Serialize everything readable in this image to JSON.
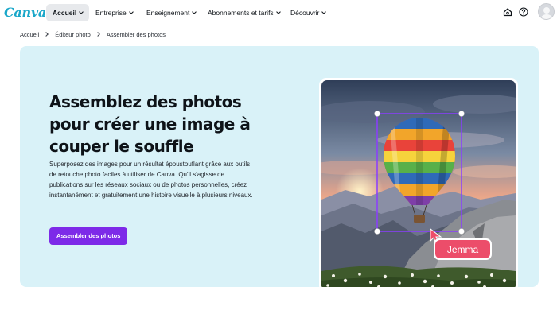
{
  "nav": {
    "logo": "Canva",
    "items": [
      {
        "label": "Accueil",
        "active": true
      },
      {
        "label": "Entreprise"
      },
      {
        "label": "Enseignement"
      },
      {
        "label": "Abonnements et tarifs"
      },
      {
        "label": "Découvrir"
      }
    ],
    "icons": [
      "home-icon",
      "help-icon",
      "avatar"
    ]
  },
  "breadcrumb": [
    "Accueil",
    "Éditeur photo",
    "Assembler des photos"
  ],
  "hero": {
    "title_lines": [
      "Assemblez des photos",
      "pour créer une image à",
      "couper le souffle"
    ],
    "description": "Superposez des images pour un résultat époustouflant grâce aux outils de retouche photo faciles à utiliser de Canva. Qu'il s'agisse de publications sur les réseaux sociaux ou de photos personnelles, créez instantanément et gratuitement une histoire visuelle à plusieurs niveaux.",
    "cta_label": "Assembler des photos",
    "collaborator_tag": "Jemma"
  },
  "colors": {
    "accent": "#7d2ae8",
    "hero_bg": "#d9f2f8",
    "logo": "#1aa7c9",
    "tag": "#ec4d6a",
    "selection": "#8b3dff"
  }
}
